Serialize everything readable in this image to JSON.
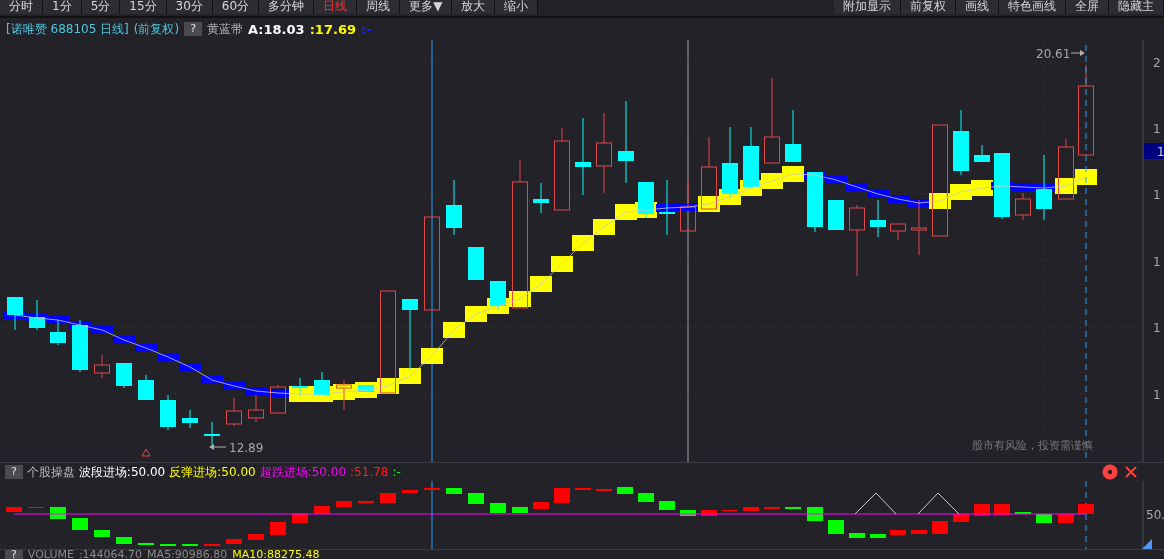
{
  "toolbar": {
    "left": [
      {
        "label": "分时",
        "selected": false
      },
      {
        "label": "1分",
        "selected": false
      },
      {
        "label": "5分",
        "selected": false
      },
      {
        "label": "15分",
        "selected": false
      },
      {
        "label": "30分",
        "selected": false
      },
      {
        "label": "60分",
        "selected": false
      },
      {
        "label": "多分钟",
        "selected": false
      },
      {
        "label": "日线",
        "selected": true
      },
      {
        "label": "周线",
        "selected": false
      },
      {
        "label": "更多▼",
        "selected": false
      },
      {
        "label": "放大",
        "selected": false
      },
      {
        "label": "缩小",
        "selected": false
      }
    ],
    "right": [
      "附加显示",
      "前复权",
      "画线",
      "特色画线",
      "全屏",
      "隐藏主"
    ]
  },
  "info": {
    "title": "[诺唯赞 688105 日线]",
    "adjust": "(前复权)",
    "help": "?",
    "indicator": "黄蓝带",
    "values": [
      {
        "text": "A:18.03",
        "color": "#ffffff"
      },
      {
        "text": ":17.69",
        "color": "#ffff00"
      },
      {
        "text": ":-",
        "color": "#2020ff"
      }
    ]
  },
  "main_chart": {
    "high_label": "20.61",
    "low_label": "12.89",
    "axis_labels": [
      "2",
      "1",
      "1",
      "1",
      "1",
      "1"
    ],
    "price_tag": "1",
    "notice": "股市有风险，投资需谨慎"
  },
  "indicator_panel": {
    "help": "?",
    "name": "个股操盘",
    "values": [
      {
        "text": "波段进场:50.00",
        "color": "#ffffff"
      },
      {
        "text": "反弹进场:50.00",
        "color": "#ffff00"
      },
      {
        "text": "超跌进场:50.00",
        "color": "#ff00ff"
      },
      {
        "text": ":51.78",
        "color": "#ff2020"
      },
      {
        "text": ":-",
        "color": "#00ff00"
      }
    ],
    "axis_label": "50."
  },
  "volume_panel": {
    "help": "?",
    "values": [
      {
        "text": "VOLUME",
        "color": "#8c8c8c"
      },
      {
        "text": ":144064.70",
        "color": "#8c8c8c"
      },
      {
        "text": "MA5:90986.80",
        "color": "#8c8c8c"
      },
      {
        "text": "MA10:88275.48",
        "color": "#ffff00"
      }
    ]
  }
}
